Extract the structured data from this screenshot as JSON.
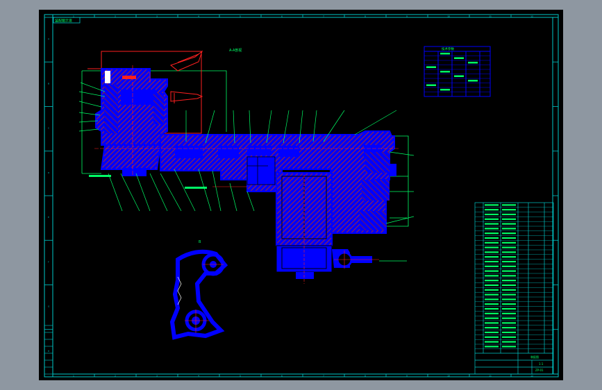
{
  "window": {
    "background": "#8e97a1",
    "canvas_background": "#000000"
  },
  "drawing": {
    "title_tab": "装配图示意",
    "section_label": "A-A剖视",
    "detail_label": "B",
    "border_color": "#00c8c8",
    "part_color": "#0000ff",
    "section_hatch_color": "#cc3300",
    "leader_color": "#00ff66",
    "column_marks_top": [
      "1",
      "2",
      "3",
      "4",
      "5",
      "6",
      "7",
      "8",
      "9",
      "10",
      "11",
      "12"
    ],
    "row_marks_left": [
      "A",
      "B",
      "C",
      "D",
      "E",
      "F",
      "G",
      "H"
    ],
    "title_block": {
      "title": "装配图",
      "scale": "1:1",
      "sheet": "1",
      "drawing_no": "ZP-01"
    },
    "tech_table_header": "技术参数"
  }
}
